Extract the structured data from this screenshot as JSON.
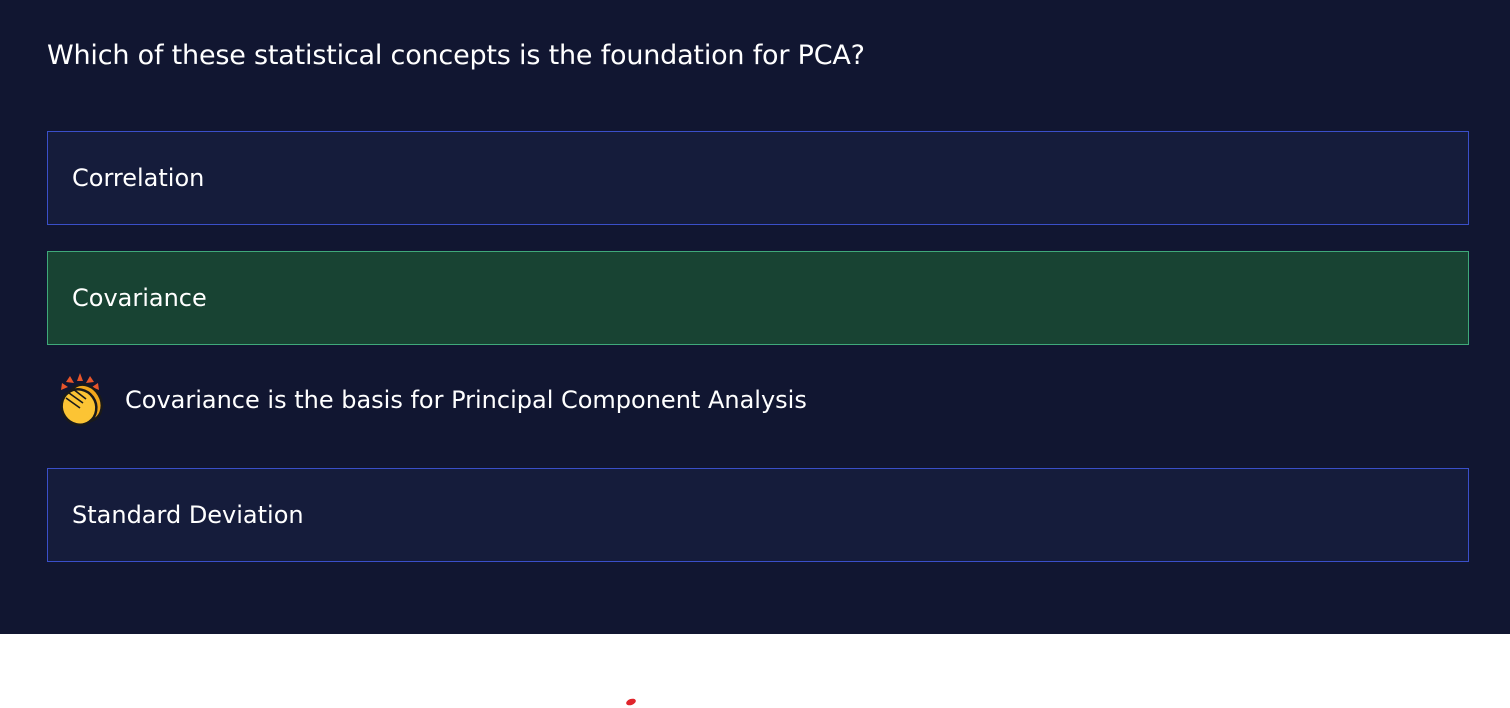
{
  "question": {
    "text": "Which of these statistical concepts is the foundation for PCA?"
  },
  "options": [
    {
      "label": "Correlation",
      "state": "default"
    },
    {
      "label": "Covariance",
      "state": "correct"
    },
    {
      "label": "Standard Deviation",
      "state": "default"
    }
  ],
  "feedback": {
    "icon": "clapping-hands-icon",
    "text": "Covariance is the basis for Principal Component Analysis"
  },
  "colors": {
    "panel_background": "#111631",
    "option_background": "#151c3b",
    "option_border": "#3a4fc9",
    "correct_background": "#184333",
    "correct_border": "#3fa97a",
    "text": "#ffffff",
    "red_mark": "#e0242b"
  }
}
